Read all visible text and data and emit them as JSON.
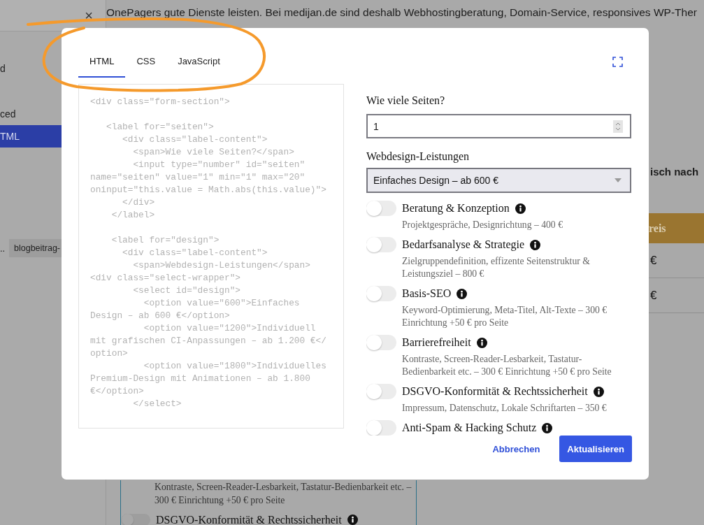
{
  "background_page": {
    "sidebar": {
      "close_label": "×",
      "items": [
        {
          "label": "d",
          "selected": false
        },
        {
          "label": "ced",
          "selected": false
        },
        {
          "label": "TML",
          "selected": true
        }
      ],
      "ellipsis": "..",
      "chip": "blogbeitrag-"
    },
    "intro_text": "OnePagers gute Dienste leisten. Bei medijan.de sind deshalb Webhostingberatung, Domain-Service, responsives WP-Ther",
    "side_heading": "isch nach",
    "price_table": {
      "header": "reis",
      "rows": [
        "€",
        "€"
      ]
    },
    "card": {
      "description": "Kontraste, Screen-Reader-Lesbarkeit, Tastatur-Bedienbarkeit etc. – 300 € Einrichtung +50 € pro Seite",
      "option": {
        "label": "DSGVO-Konformität & Rechtssicherheit",
        "on": false
      }
    }
  },
  "dialog": {
    "tabs": [
      {
        "label": "HTML",
        "selected": true
      },
      {
        "label": "CSS",
        "selected": false
      },
      {
        "label": "JavaScript",
        "selected": false
      }
    ],
    "code": "<div class=\"form-section\">\n\n   <label for=\"seiten\">\n      <div class=\"label-content\">\n        <span>Wie viele Seiten?</span>\n        <input type=\"number\" id=\"seiten\"\nname=\"seiten\" value=\"1\" min=\"1\" max=\"20\"\noninput=\"this.value = Math.abs(this.value)\">\n      </div>\n    </label>\n\n    <label for=\"design\">\n      <div class=\"label-content\">\n        <span>Webdesign-Leistungen</span>\n<div class=\"select-wrapper\">\n        <select id=\"design\">\n          <option value=\"600\">Einfaches\nDesign – ab 600 €</option>\n          <option value=\"1200\">Individuell\nmit grafischen CI-Anpassungen – ab 1.200 €</\noption>\n          <option value=\"1800\">Individuelles\nPremium-Design mit Animationen – ab 1.800\n€</option>\n        </select>",
    "form": {
      "pages_label": "Wie viele Seiten?",
      "pages_value": "1",
      "design_label": "Webdesign-Leistungen",
      "design_value": "Einfaches Design – ab 600 €",
      "services": [
        {
          "name": "Beratung & Konzeption",
          "description": "Projektgespräche, Designrichtung – 400 €",
          "on": false
        },
        {
          "name": "Bedarfsanalyse & Strategie",
          "description": "Zielgruppendefinition, effizente Seitenstruktur & Leistungsziel – 800 €",
          "on": false
        },
        {
          "name": "Basis-SEO",
          "description": "Keyword-Optimierung, Meta-Titel, Alt-Texte – 300 € Einrichtung +50 € pro Seite",
          "on": false
        },
        {
          "name": "Barrierefreiheit",
          "description": "Kontraste, Screen-Reader-Lesbarkeit, Tastatur-Bedienbarkeit etc. – 300 € Einrichtung +50 € pro Seite",
          "on": false
        },
        {
          "name": "DSGVO-Konformität & Rechtssicherheit",
          "description": "Impressum, Datenschutz, Lokale Schriftarten – 350 €",
          "on": false
        },
        {
          "name": "Anti-Spam & Hacking Schutz",
          "on": false
        }
      ]
    },
    "buttons": [
      {
        "label": "Abbrechen",
        "kind": "text"
      },
      {
        "label": "Aktualisieren",
        "kind": "primary"
      }
    ]
  }
}
